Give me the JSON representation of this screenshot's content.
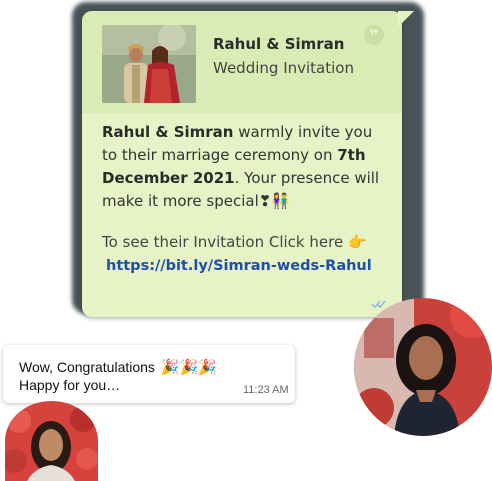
{
  "link_preview": {
    "title": "Rahul & Simran",
    "subtitle": "Wedding Invitation",
    "thumbnail_icon": "couple-photo",
    "quote_icon": "quote-icon"
  },
  "message": {
    "names": "Rahul & Simran",
    "text_a": " warmly invite you to their marriage ceremony on ",
    "date": "7th December 2021",
    "text_b": ". Your presence will make it more special",
    "emoji": "❣👫",
    "cta": "To see their Invitation Click here 👉",
    "link": "https://bit.ly/Simran-weds-Rahul",
    "read_status": "double-check-icon"
  },
  "reply": {
    "line1": "Wow, Congratulations",
    "emoji": "🎉🎉🎉",
    "line2": "Happy for you…",
    "time": "11:23 AM"
  },
  "colors": {
    "bubble": "#e6f3c7",
    "preview_bar": "#d9ecb6",
    "link": "#1f4ea8",
    "tick": "#8fb8d6"
  }
}
